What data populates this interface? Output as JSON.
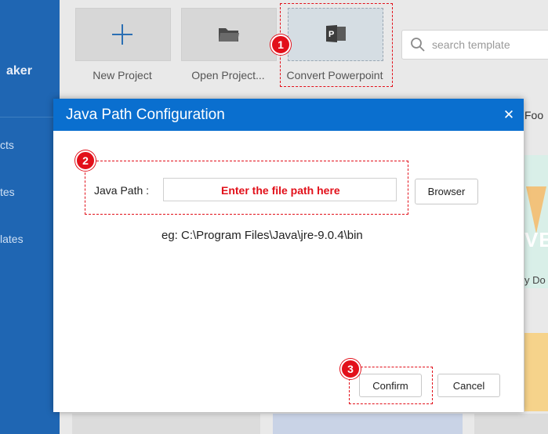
{
  "app": {
    "brand_partial": "aker",
    "nav_items": [
      "cts",
      "tes",
      "lates"
    ]
  },
  "toolbar": {
    "new_project_label": "New Project",
    "open_project_label": "Open Project...",
    "convert_label": "Convert Powerpoint"
  },
  "search": {
    "placeholder": "search template"
  },
  "background_cards": {
    "food_label": "Foo",
    "card_text": "VE",
    "do_label": "y Do"
  },
  "dialog": {
    "title": "Java Path Configuration",
    "close_label": "✕",
    "java_path_label": "Java Path :",
    "path_value": "",
    "browse_label": "Browser",
    "example": "eg: C:\\Program Files\\Java\\jre-9.0.4\\bin",
    "confirm_label": "Confirm",
    "cancel_label": "Cancel"
  },
  "annotations": {
    "steps": [
      "1",
      "2",
      "3"
    ],
    "hint": "Enter the file path here",
    "color": "#e2101a"
  },
  "colors": {
    "sidebar": "#1f66b3",
    "dialog_header": "#0a6fcf",
    "accent_plus": "#2b6fb3"
  },
  "icons": [
    "plus-icon",
    "folder-icon",
    "powerpoint-icon",
    "search-icon",
    "close-icon"
  ]
}
